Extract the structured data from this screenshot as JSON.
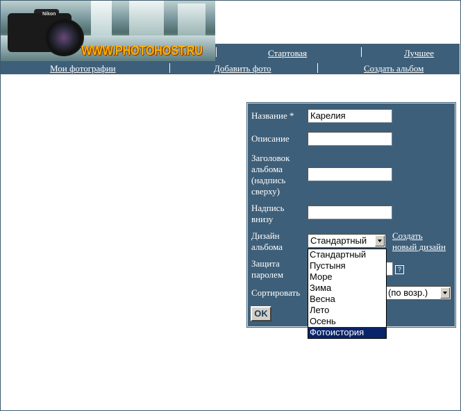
{
  "header": {
    "site_name": "WWW.PHOTOHOST.RU",
    "camera_brand": "Nikon",
    "top_nav": [
      "Стартовая",
      "Лучшее"
    ],
    "sub_nav": [
      "Мои фотографии",
      "Добавить фото",
      "Создать альбом"
    ]
  },
  "form": {
    "name_label": "Название *",
    "name_value": "Карелия",
    "description_label": "Описание",
    "description_value": "",
    "header_label": [
      "Заголовок",
      "альбома",
      "(надпись",
      "сверху)"
    ],
    "header_value": "",
    "footer_label": [
      "Надпись",
      "внизу"
    ],
    "footer_value": "",
    "design_label": [
      "Дизайн",
      "альбома"
    ],
    "design_value": "Стандартный",
    "create_design_link": [
      "Создать",
      "новый дизайн"
    ],
    "password_label": [
      "Защита",
      "паролем"
    ],
    "help_icon": "?",
    "sort_label": "Сортировать",
    "sort_value": "(по возр.)",
    "ok_label": "OK"
  },
  "design_options": [
    "Стандартный",
    "Пустыня",
    "Море",
    "Зима",
    "Весна",
    "Лето",
    "Осень",
    "Фотоистория"
  ],
  "design_options_highlighted": "Фотоистория",
  "colors": {
    "nav_bg": "#3e5f79",
    "highlight": "#0a246a",
    "logo_text": "#ffb000"
  }
}
